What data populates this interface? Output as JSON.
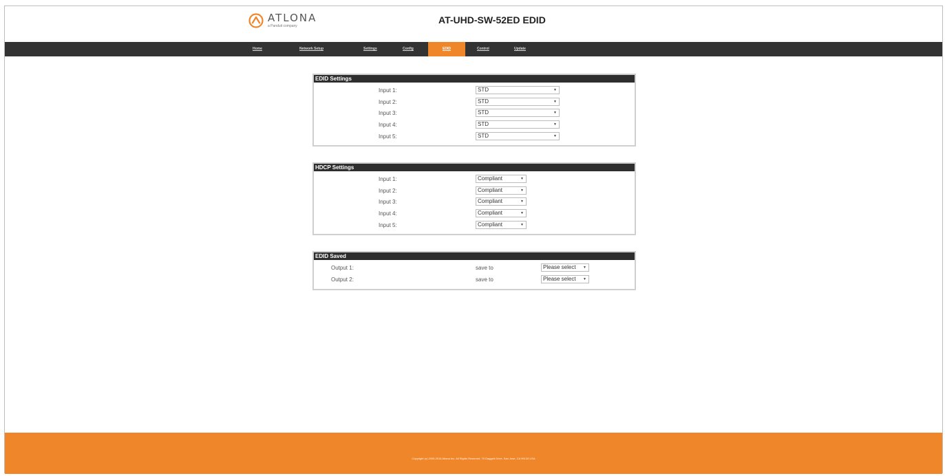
{
  "header": {
    "logo_name": "ATLONA",
    "logo_sub": "a Panduit company",
    "title": "AT-UHD-SW-52ED EDID"
  },
  "nav": [
    {
      "label": "Home",
      "active": false
    },
    {
      "label": "Network Setup",
      "active": false
    },
    {
      "label": "Settings",
      "active": false
    },
    {
      "label": "Config",
      "active": false
    },
    {
      "label": "EDID",
      "active": true
    },
    {
      "label": "Control",
      "active": false
    },
    {
      "label": "Update",
      "active": false
    }
  ],
  "edid_settings": {
    "title": "EDID Settings",
    "rows": [
      {
        "label": "Input 1:",
        "value": "STD"
      },
      {
        "label": "Input 2:",
        "value": "STD"
      },
      {
        "label": "Input 3:",
        "value": "STD"
      },
      {
        "label": "Input 4:",
        "value": "STD"
      },
      {
        "label": "Input 5:",
        "value": "STD"
      }
    ]
  },
  "hdcp_settings": {
    "title": "HDCP Settings",
    "rows": [
      {
        "label": "Input 1:",
        "value": "Compliant"
      },
      {
        "label": "Input 2:",
        "value": "Compliant"
      },
      {
        "label": "Input 3:",
        "value": "Compliant"
      },
      {
        "label": "Input 4:",
        "value": "Compliant"
      },
      {
        "label": "Input 5:",
        "value": "Compliant"
      }
    ]
  },
  "edid_saved": {
    "title": "EDID Saved",
    "rows": [
      {
        "label": "Output 1:",
        "save_label": "save to",
        "value": "Please select"
      },
      {
        "label": "Output 2:",
        "save_label": "save to",
        "value": "Please select"
      }
    ]
  },
  "footer": {
    "text": "Copyright (c) 2005-2016 Atlona Inc. All Rights Reserved. 70 Daggett Drive, San Jose, CA 95134 USA"
  },
  "colors": {
    "accent": "#f0862a",
    "navbar": "#333333",
    "panel_header": "#2e2e2e"
  }
}
